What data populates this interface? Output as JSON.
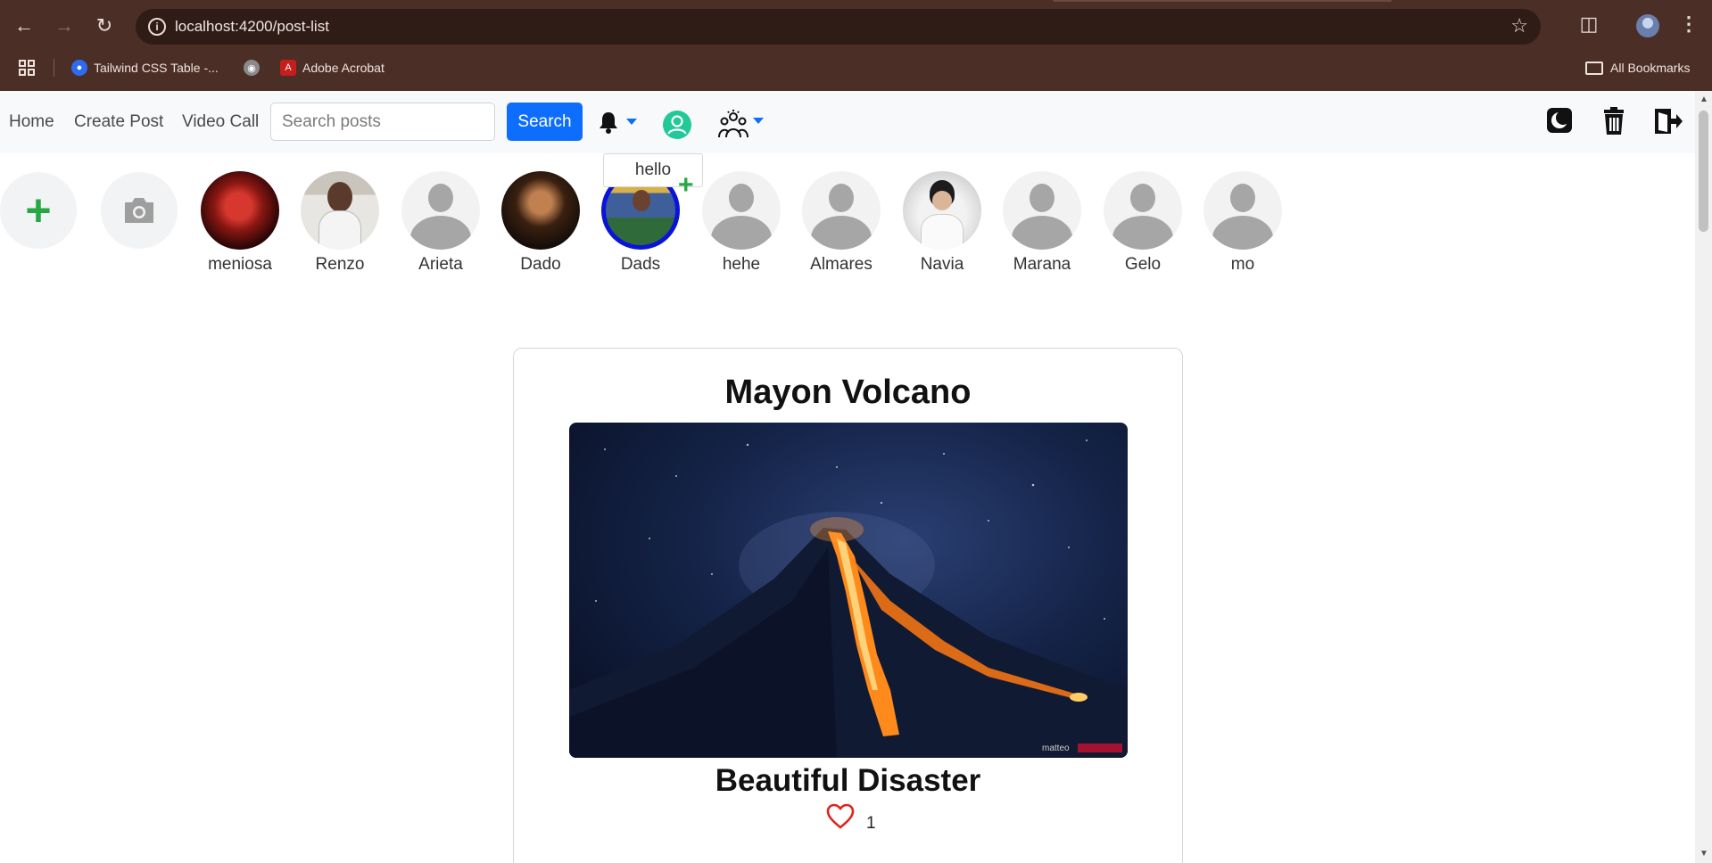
{
  "browser": {
    "url": "localhost:4200/post-list",
    "bookmarks": [
      {
        "label": "Tailwind CSS Table -..."
      },
      {
        "label": "Adobe Acrobat"
      }
    ],
    "all_bookmarks_label": "All Bookmarks"
  },
  "navbar": {
    "links": [
      "Home",
      "Create Post",
      "Video Call"
    ],
    "search_placeholder": "Search posts",
    "search_button": "Search",
    "accent_color": "#0d6efd"
  },
  "stories": {
    "tooltip": "hello",
    "people": [
      {
        "name": "meniosa"
      },
      {
        "name": "Renzo"
      },
      {
        "name": "Arieta"
      },
      {
        "name": "Dado"
      },
      {
        "name": "Dads"
      },
      {
        "name": "hehe"
      },
      {
        "name": "Almares"
      },
      {
        "name": "Navia"
      },
      {
        "name": "Marana"
      },
      {
        "name": "Gelo"
      },
      {
        "name": "mo"
      }
    ]
  },
  "post": {
    "title": "Mayon Volcano",
    "subtitle": "Beautiful Disaster",
    "likes": "1",
    "image_watermark": "matteo"
  }
}
